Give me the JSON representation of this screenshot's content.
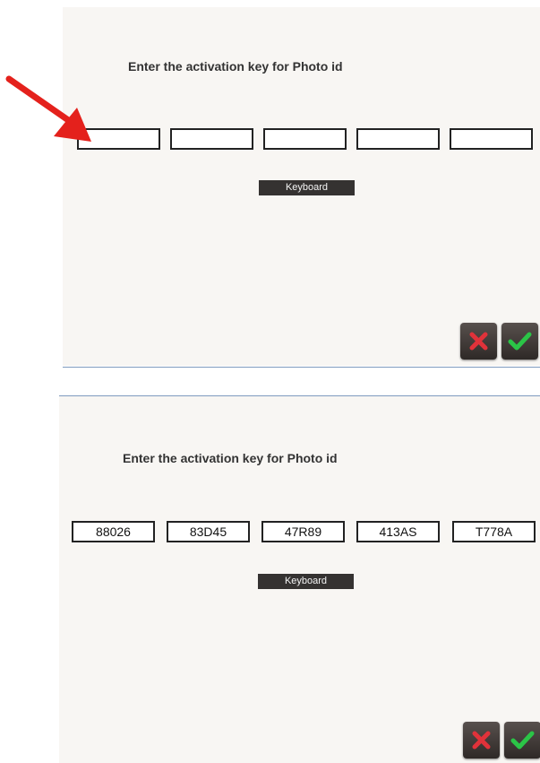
{
  "top_dialog": {
    "title": "Enter the activation key for Photo id",
    "fields": [
      "",
      "",
      "",
      "",
      ""
    ],
    "keyboard_label": "Keyboard",
    "annotation": {
      "color": "#e4211c"
    }
  },
  "bottom_dialog": {
    "title": "Enter the activation key for Photo id",
    "fields": [
      "88026",
      "83D45",
      "47R89",
      "413AS",
      "T778A"
    ],
    "keyboard_label": "Keyboard"
  },
  "icons": {
    "cancel": "close-x-icon",
    "confirm": "checkmark-icon"
  },
  "colors": {
    "cancel_red": "#e0323a",
    "confirm_green": "#2bc447",
    "button_dark": "#353231",
    "panel_bg": "#f8f6f3",
    "separator": "#7f9bbf"
  }
}
